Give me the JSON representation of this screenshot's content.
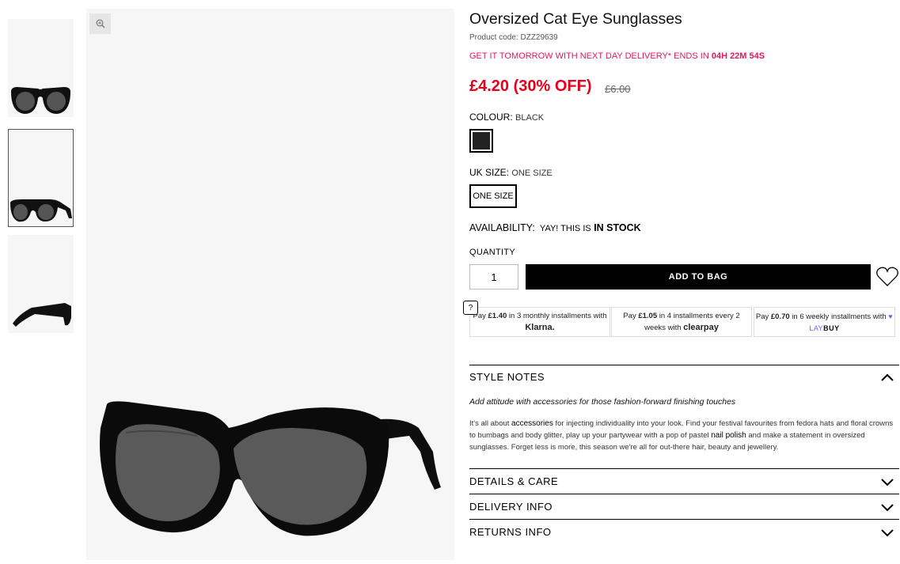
{
  "gallery": {
    "thumbnails": [
      "front-view",
      "angled-view",
      "side-view"
    ],
    "active_index": 1,
    "zoom_icon": "zoom-in-icon"
  },
  "product": {
    "title": "Oversized Cat Eye Sunglasses",
    "code": "Product code: DZZ29639",
    "delivery_prefix": "GET IT TOMORROW WITH NEXT DAY DELIVERY* ENDS IN ",
    "delivery_countdown": "04H 22M 54S",
    "price": "£4.20 (30% OFF)",
    "old_price": "£6.00"
  },
  "colour": {
    "label": "COLOUR:",
    "value": "BLACK",
    "swatch_color": "#222222"
  },
  "size": {
    "label": "UK SIZE:",
    "value": "ONE SIZE",
    "option": "ONE SIZE"
  },
  "availability": {
    "label": "AVAILABILITY:",
    "message": "YAY! THIS IS",
    "status": "IN STOCK"
  },
  "quantity": {
    "label": "QUANTITY",
    "value": "1"
  },
  "actions": {
    "add_to_bag": "ADD TO BAG",
    "wishlist_icon": "heart-icon",
    "help": "?"
  },
  "payments": [
    {
      "pre": "Pay ",
      "amount": "£1.40",
      "mid": " in 3 monthly installments with ",
      "brand": "Klarna."
    },
    {
      "pre": "Pay ",
      "amount": "£1.05",
      "mid": " in 4 installments every 2 weeks with ",
      "brand": "clearpay"
    },
    {
      "pre": "Pay ",
      "amount": "£0.70",
      "mid": " in 6 weekly installments with ",
      "brand_a": "LAY",
      "brand_b": "BUY"
    }
  ],
  "style_notes": {
    "heading": "STYLE NOTES",
    "subheading": "Add attitude with accessories for those fashion-forward finishing touches",
    "body_1": "It's all about ",
    "link_1": "accessories",
    "body_2": " for injecting individuality into your look. Find your festival favourites from fedora hats and floral crowns to bumbags and body glitter, play up your partywear with a pop of pastel ",
    "link_2": "nail polish",
    "body_3": " and make a statement in oversized sunglasses. Forget less is more, this season we're all for out-there hair, beauty and jewellery."
  },
  "accordions": [
    "DETAILS & CARE",
    "DELIVERY INFO",
    "RETURNS INFO"
  ],
  "colors": {
    "sale_red": "#e4001b",
    "delivery_pink": "#e0195f",
    "button_black": "#000000"
  }
}
